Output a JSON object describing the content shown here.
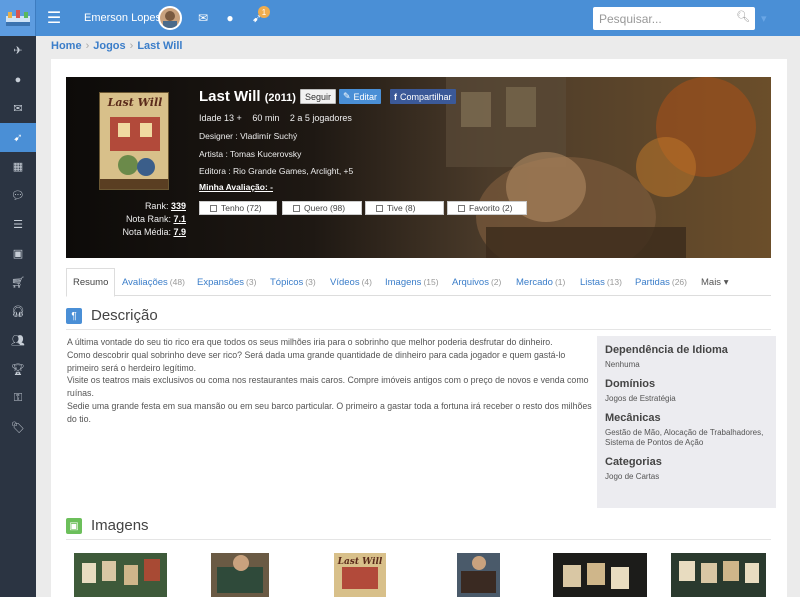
{
  "topbar": {
    "user_name": "Emerson Lopes",
    "notification_count": "1",
    "search_placeholder": "Pesquisar..."
  },
  "sidebar": {
    "items": [
      "plane-icon",
      "user-icon",
      "envelope-icon",
      "rocket-icon",
      "grid-icon",
      "comments-icon",
      "list-icon",
      "image-icon",
      "cart-icon",
      "headset-icon",
      "group-icon",
      "trophy-icon",
      "key-icon",
      "tag-icon"
    ],
    "active_index": 3
  },
  "breadcrumb": [
    "Home",
    "Jogos",
    "Last Will"
  ],
  "game": {
    "title": "Last Will",
    "year": "(2011)",
    "follow_label": "Seguir",
    "edit_label": "Editar",
    "share_label": "Compartilhar",
    "age": "Idade 13 +",
    "duration": "60 min",
    "players": "2 a 5 jogadores",
    "designer": "Designer : Vladimír Suchý",
    "artist": "Artista : Tomas Kucerovsky",
    "publisher": "Editora : Rio Grande Games, Arclight, +5",
    "my_rating": "Minha Avaliação: -",
    "rank_label": "Rank:",
    "rank_value": "339",
    "rank_note_label": "Nota Rank:",
    "rank_note_value": "7.1",
    "avg_note_label": "Nota Média:",
    "avg_note_value": "7.9",
    "cover_title": "Last Will",
    "status_buttons": [
      {
        "label": "Tenho (72)"
      },
      {
        "label": "Quero (98)"
      },
      {
        "label": "Tive (8)"
      },
      {
        "label": "Favorito (2)"
      }
    ]
  },
  "tabs": [
    {
      "label": "Resumo",
      "count": ""
    },
    {
      "label": "Avaliações",
      "count": "(48)"
    },
    {
      "label": "Expansões",
      "count": "(3)"
    },
    {
      "label": "Tópicos",
      "count": "(3)"
    },
    {
      "label": "Vídeos",
      "count": "(4)"
    },
    {
      "label": "Imagens",
      "count": "(15)"
    },
    {
      "label": "Arquivos",
      "count": "(2)"
    },
    {
      "label": "Mercado",
      "count": "(1)"
    },
    {
      "label": "Listas",
      "count": "(13)"
    },
    {
      "label": "Partidas",
      "count": "(26)"
    },
    {
      "label": "Mais ▾",
      "count": ""
    }
  ],
  "description": {
    "heading": "Descrição",
    "paragraphs": [
      "A última vontade do seu tio rico era que todos os seus milhões iria para o sobrinho que melhor poderia desfrutar do dinheiro.",
      "Como descobrir qual sobrinho deve ser rico? Será dada uma grande quantidade de dinheiro para cada jogador e quem gastá-lo primeiro será o herdeiro legítimo.",
      "Visite os teatros mais exclusivos ou coma nos restaurantes mais caros. Compre imóveis antigos com o preço de novos e venda como ruínas.",
      "Sedie uma grande festa em sua mansão ou em seu barco particular. O primeiro a gastar toda a fortuna irá receber o resto dos milhões do tio."
    ]
  },
  "info": {
    "language_h": "Dependência de Idioma",
    "language_v": "Nenhuma",
    "domains_h": "Domínios",
    "domains_v": "Jogos de Estratégia",
    "mechanics_h": "Mecânicas",
    "mechanics_v": "Gestão de Mão, Alocação de Trabalhadores, Sistema de Pontos de Ação",
    "categories_h": "Categorias",
    "categories_v": "Jogo de Cartas"
  },
  "images": {
    "heading": "Imagens",
    "thumb_names": [
      "game-photo-1",
      "game-photo-2",
      "box-cover-photo",
      "game-photo-3",
      "game-photo-4",
      "game-photo-5"
    ]
  },
  "colors": {
    "topbar": "#4a8fd6",
    "sidebar": "#2b3442",
    "accent": "#3a7dc9",
    "section_icon_blue": "#4a8fd6",
    "section_icon_green": "#6cbf5b"
  }
}
